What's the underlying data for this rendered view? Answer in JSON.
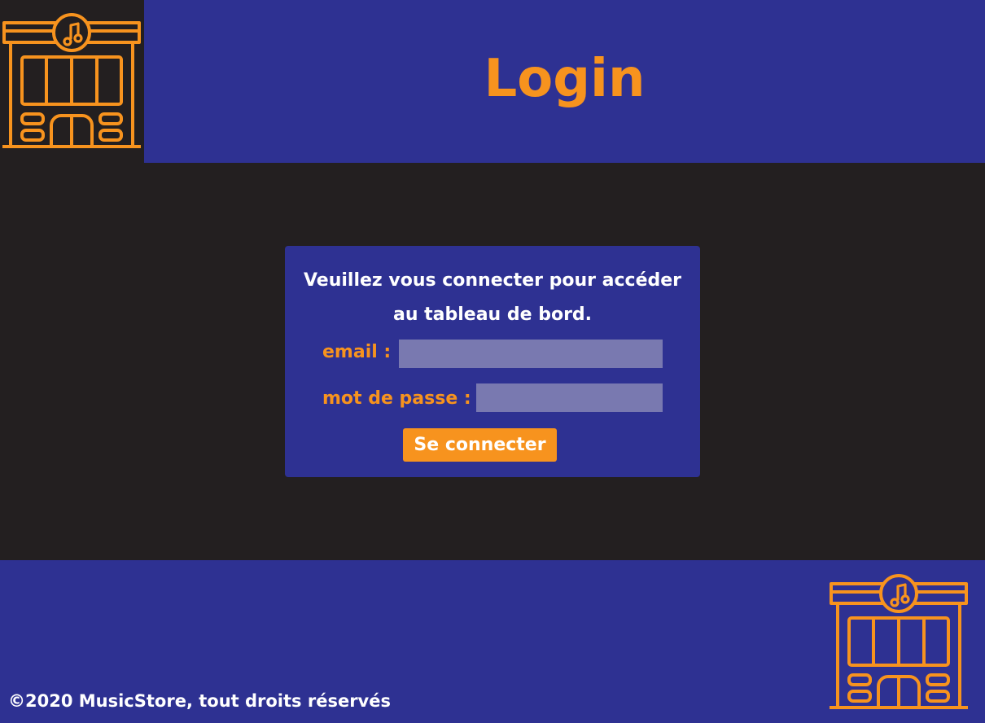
{
  "header": {
    "title": "Login",
    "logo_icon": "music-store-icon"
  },
  "login": {
    "message": "Veuillez vous connecter pour accéder au tableau de bord.",
    "email_label": "email :",
    "email_value": "",
    "password_label": "mot de passe :",
    "password_value": "",
    "submit_label": "Se connecter"
  },
  "footer": {
    "copyright": "©2020 MusicStore, tout droits réservés",
    "logo_icon": "music-store-icon"
  },
  "colors": {
    "background": "#231f20",
    "brand_blue": "#2e3192",
    "accent_orange": "#f7931e",
    "input_fill": "#7979b0",
    "text_white": "#ffffff"
  }
}
